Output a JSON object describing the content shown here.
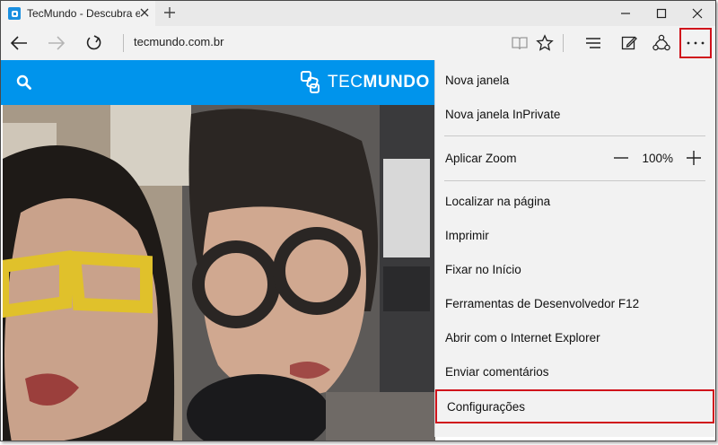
{
  "browser": {
    "tab": {
      "title": "TecMundo - Descubra e"
    },
    "address": {
      "url": "tecmundo.com.br"
    }
  },
  "site": {
    "logo": {
      "part1": "TEC",
      "part2": "MUNDO"
    },
    "brand_color": "#0094ec"
  },
  "menu": {
    "items": [
      {
        "label": "Nova janela"
      },
      {
        "label": "Nova janela InPrivate"
      },
      {
        "label": "Aplicar Zoom"
      },
      {
        "label": "Localizar na página"
      },
      {
        "label": "Imprimir"
      },
      {
        "label": "Fixar no Início"
      },
      {
        "label": "Ferramentas de Desenvolvedor F12"
      },
      {
        "label": "Abrir com o Internet Explorer"
      },
      {
        "label": "Enviar comentários"
      },
      {
        "label": "Configurações"
      }
    ],
    "zoom": {
      "value": "100%"
    }
  },
  "colors": {
    "highlight": "#d0121b"
  }
}
